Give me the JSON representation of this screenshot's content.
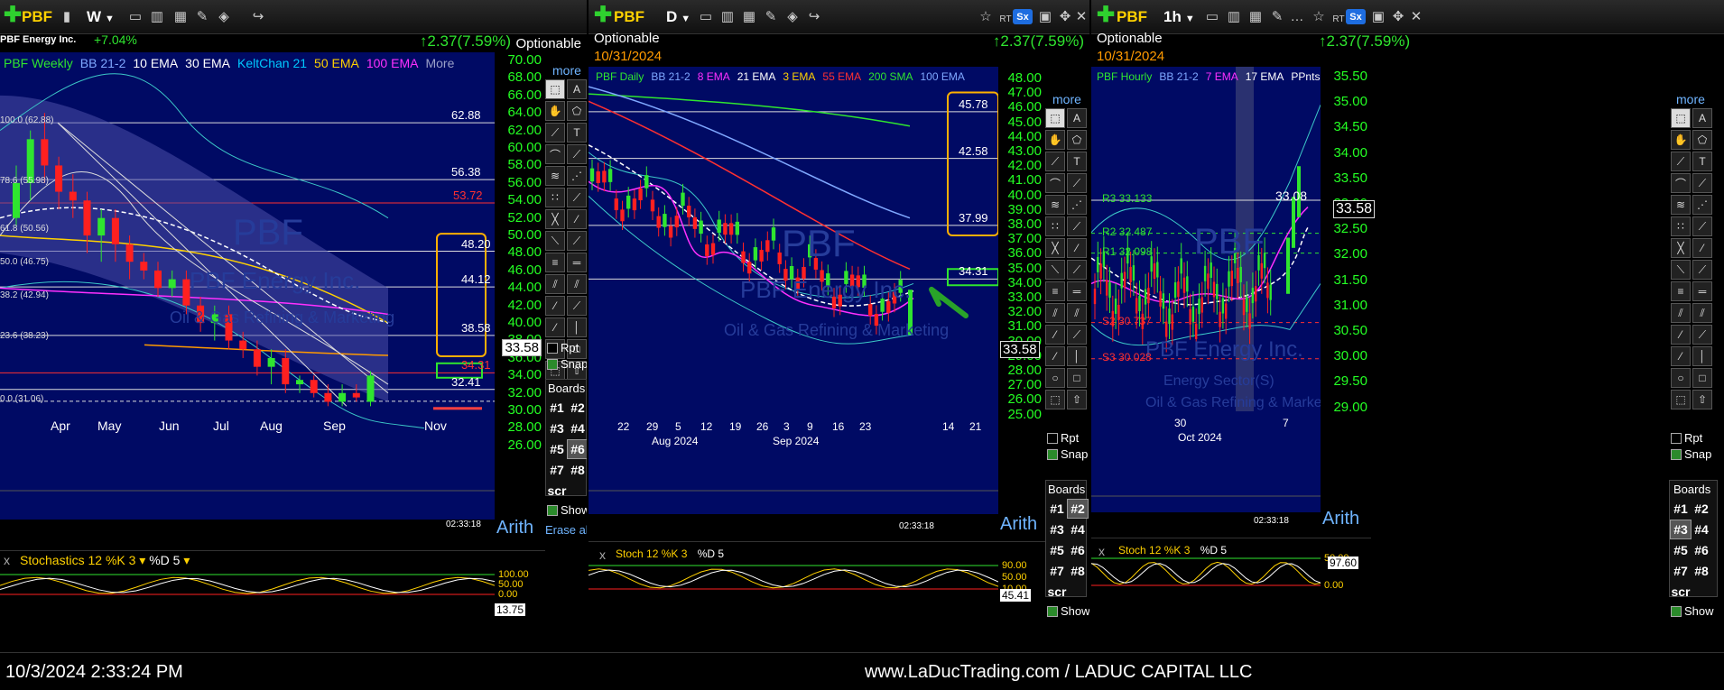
{
  "panels": [
    {
      "symbol": "PBF",
      "interval": "W",
      "company": "PBF Energy Inc.",
      "pct_change": "+7.04%",
      "change": "2.37(7.59%)",
      "optionable": "Optionable",
      "legend": [
        {
          "text": "PBF Weekly",
          "color": "#2fe52f"
        },
        {
          "text": "BB 21-2",
          "color": "#7fa8ff"
        },
        {
          "text": "10 EMA",
          "color": "#ffffff"
        },
        {
          "text": "30 EMA",
          "color": "#ffffff"
        },
        {
          "text": "KeltChan 21",
          "color": "#00c8ff"
        },
        {
          "text": "50 EMA",
          "color": "#ffd100"
        },
        {
          "text": "100 EMA",
          "color": "#ff30ff"
        },
        {
          "text": "More",
          "color": "#9aa0c8"
        }
      ],
      "price_ticks": [
        "70.00",
        "68.00",
        "66.00",
        "64.00",
        "62.00",
        "60.00",
        "58.00",
        "56.00",
        "54.00",
        "52.00",
        "50.00",
        "48.00",
        "46.00",
        "44.00",
        "42.00",
        "40.00",
        "38.00",
        "36.00",
        "34.00",
        "32.00",
        "30.00",
        "28.00",
        "26.00"
      ],
      "fib_labels": [
        "100.0 (62.88)",
        "78.6 (55.98)",
        "61.8 (50.56)",
        "50.0 (46.75)",
        "38.2 (42.94)",
        "23.6 (38.23)",
        "0.0 (31.06)"
      ],
      "levels": [
        "62.88",
        "56.38",
        "53.72",
        "48.20",
        "44.12",
        "38.58",
        "34.31",
        "32.41"
      ],
      "last_price": "33.58",
      "x_labels": [
        "Apr",
        "May",
        "Jun",
        "Jul",
        "Aug",
        "Sep",
        "Nov"
      ],
      "time": "02:33:18",
      "scale": "Arith",
      "watermark": {
        "symbol": "PBF",
        "name": "PBF Energy Inc.",
        "sector": "Oil & Gas Refining & Marketing"
      },
      "stoch": {
        "label": "Stochastics 12 %K 3",
        "d": "%D 5",
        "ticks": [
          "100.00",
          "50.00",
          "0.00"
        ],
        "value": "13.75"
      }
    },
    {
      "symbol": "PBF",
      "interval": "D",
      "optionable": "Optionable",
      "date": "10/31/2024",
      "change": "2.37(7.59%)",
      "legend": [
        {
          "text": "PBF Daily",
          "color": "#2fe52f"
        },
        {
          "text": "BB 21-2",
          "color": "#7fa8ff"
        },
        {
          "text": "8 EMA",
          "color": "#ff30ff"
        },
        {
          "text": "21 EMA",
          "color": "#ffffff"
        },
        {
          "text": "3 EMA",
          "color": "#ffd100"
        },
        {
          "text": "55 EMA",
          "color": "#ff3030"
        },
        {
          "text": "200 SMA",
          "color": "#2fe52f"
        },
        {
          "text": "100 EMA",
          "color": "#7fa8ff"
        }
      ],
      "price_ticks": [
        "48.00",
        "47.00",
        "46.00",
        "45.00",
        "44.00",
        "43.00",
        "42.00",
        "41.00",
        "40.00",
        "39.00",
        "38.00",
        "37.00",
        "36.00",
        "35.00",
        "34.00",
        "33.00",
        "32.00",
        "31.00",
        "30.00",
        "29.00",
        "28.00",
        "27.00",
        "26.00",
        "25.00"
      ],
      "levels": [
        "45.78",
        "42.58",
        "37.99",
        "34.31"
      ],
      "last_price": "33.58",
      "x_labels": [
        "22",
        "29",
        "5",
        "12",
        "19",
        "26",
        "3",
        "9",
        "16",
        "23",
        "14",
        "21"
      ],
      "month_labels": [
        "Aug 2024",
        "Sep 2024"
      ],
      "time": "02:33:18",
      "scale": "Arith",
      "watermark": {
        "symbol": "PBF",
        "name": "PBF Energy Inc.",
        "sector": "Oil & Gas Refining & Marketing"
      },
      "stoch": {
        "label": "Stoch 12 %K 3",
        "d": "%D 5",
        "ticks": [
          "90.00",
          "50.00",
          "10.00"
        ],
        "value": "45.41"
      }
    },
    {
      "symbol": "PBF",
      "interval": "1h",
      "optionable": "Optionable",
      "date": "10/31/2024",
      "change": "2.37(7.59%)",
      "legend": [
        {
          "text": "PBF Hourly",
          "color": "#2fe52f"
        },
        {
          "text": "BB 21-2",
          "color": "#7fa8ff"
        },
        {
          "text": "7 EMA",
          "color": "#ff30ff"
        },
        {
          "text": "17 EMA",
          "color": "#ffffff"
        },
        {
          "text": "PPnts",
          "color": "#ffffff"
        }
      ],
      "price_ticks": [
        "35.50",
        "35.00",
        "34.50",
        "34.00",
        "33.50",
        "33.00",
        "32.50",
        "32.00",
        "31.50",
        "31.00",
        "30.50",
        "30.00",
        "29.50",
        "29.00"
      ],
      "pivots": [
        "R3 33.133",
        "R2 32.487",
        "R1 32.098",
        "S2 30.737",
        "S3 30.028"
      ],
      "levels": [
        "33.08"
      ],
      "last_price": "33.58",
      "x_labels": [
        "30",
        "7"
      ],
      "month_labels": [
        "Oct 2024"
      ],
      "time": "02:33:18",
      "scale": "Arith",
      "watermark": {
        "symbol": "PBF",
        "name": "PBF Energy Inc.",
        "sector": "Oil & Gas Refining & Marketing",
        "sector_short": "Energy Sector(S)"
      },
      "stoch": {
        "label": "Stoch 12 %K 3",
        "d": "%D 5",
        "ticks": [
          "50.00",
          "0.00"
        ],
        "value": "97.60"
      }
    }
  ],
  "tools_panel": {
    "more": "more",
    "rpt": "Rpt",
    "snap": "Snap",
    "boards": "Boards",
    "board_items": [
      "#1",
      "#2",
      "#3",
      "#4",
      "#5",
      "#6",
      "#7",
      "#8",
      "scr"
    ],
    "show": "Show",
    "erase_all": "Erase all"
  },
  "footer": {
    "timestamp": "10/3/2024 2:33:24 PM",
    "site": "www.LaDucTrading.com / LADUC CAPITAL LLC"
  },
  "colors": {
    "chart_bg": "#000a64",
    "up": "#2fe52f",
    "down": "#ff2020",
    "symbol": "#ffd100",
    "level_box": "#ffb000"
  }
}
